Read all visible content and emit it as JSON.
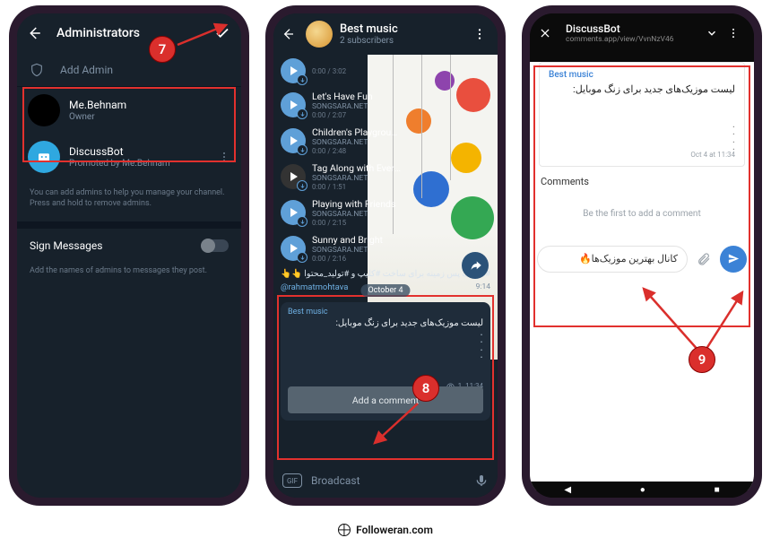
{
  "annotations": {
    "step7": "7",
    "step8": "8",
    "step9": "9"
  },
  "footer": {
    "site": "Followeran.com"
  },
  "phone1": {
    "header_title": "Administrators",
    "add_admin_label": "Add Admin",
    "admins": [
      {
        "name": "Me.Behnam",
        "sub": "Owner"
      },
      {
        "name": "DiscussBot",
        "sub": "Promoted by Me.Behnam"
      }
    ],
    "help_text": "You can add admins to help you manage your channel. Press and hold to remove admins.",
    "sign_messages_label": "Sign Messages",
    "sign_messages_help": "Add the names of admins to messages they post."
  },
  "phone2": {
    "channel_title": "Best music",
    "channel_sub": "2 subscribers",
    "songs": [
      {
        "title": "—",
        "artist": "—",
        "dur": "0:00 / 3:02"
      },
      {
        "title": "Let's Have Fun",
        "artist": "SONGSARA.NET",
        "dur": "0:00 / 2:07"
      },
      {
        "title": "Children's Playground",
        "artist": "SONGSARA.NET",
        "dur": "0:00 / 2:48"
      },
      {
        "title": "Tag Along with Every...",
        "artist": "SONGSARA.NET",
        "dur": "0:00 / 1:51"
      },
      {
        "title": "Playing with Friends",
        "artist": "SONGSARA.NET",
        "dur": "0:00 / 2:15"
      },
      {
        "title": "Sunny and Bright",
        "artist": "SONGSARA.NET",
        "dur": "0:00 / 2:16"
      }
    ],
    "caption_line1": "#موزیک پس زمینه برای ساخت #کلیپ و #تولید_محتوا 👆👆",
    "caption_mention": "@rahmatmohtava",
    "caption_time": "9:14",
    "date_pill": "October 4",
    "quoted_title": "Best music",
    "quoted_msg": "لیست موزیک‌های جدید برای زنگ موبایل:",
    "quoted_views": "1",
    "quoted_time": "11:34",
    "add_comment_label": "Add a comment",
    "input_placeholder": "Broadcast",
    "gif_label": "GIF"
  },
  "phone3": {
    "title": "DiscussBot",
    "url": "comments.app/view/VvnNzV46",
    "card_title": "Best music",
    "card_msg": "لیست موزیک‌های جدید برای زنگ موبایل:",
    "card_date": "Oct 4 at 11:34",
    "comments_heading": "Comments",
    "empty_text": "Be the first to add a comment",
    "input_value": "کانال بهترین موزیک‌ها🔥"
  }
}
